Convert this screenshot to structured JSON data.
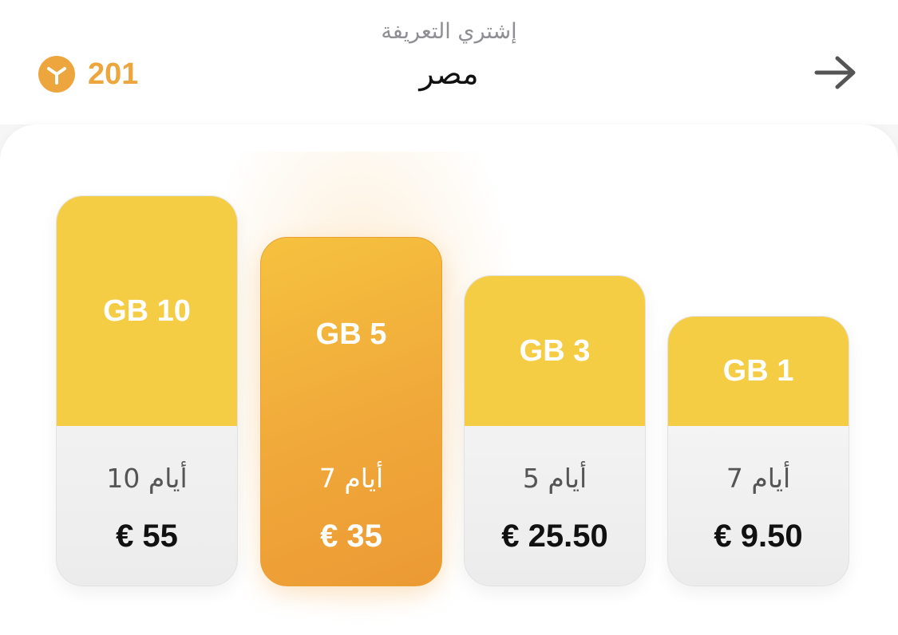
{
  "header": {
    "subtitle": "إشتري التعريفة",
    "title": "مصر",
    "coins": "201",
    "coin_icon": "coin-icon",
    "back_icon": "arrow-right-icon"
  },
  "plans": [
    {
      "data": "GB 10",
      "duration": "10 أيام",
      "price": "€ 55",
      "selected": false
    },
    {
      "data": "GB 5",
      "duration": "7 أيام",
      "price": "€ 35",
      "selected": true
    },
    {
      "data": "GB 3",
      "duration": "5 أيام",
      "price": "€ 25.50",
      "selected": false
    },
    {
      "data": "GB 1",
      "duration": "7 أيام",
      "price": "€ 9.50",
      "selected": false
    }
  ],
  "colors": {
    "accent": "#eca63d",
    "card_top": "#f5cd45",
    "selected_card": "#f0a83a"
  }
}
